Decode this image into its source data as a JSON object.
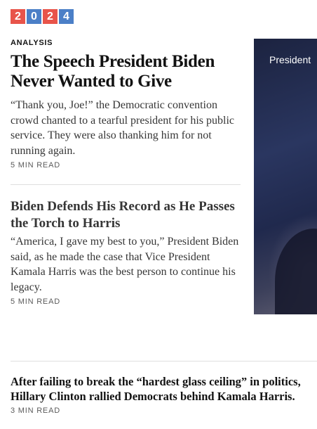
{
  "logo": {
    "digits": [
      {
        "char": "2",
        "color": "#e8544a"
      },
      {
        "char": "0",
        "color": "#4b7fc7"
      },
      {
        "char": "2",
        "color": "#e8544a"
      },
      {
        "char": "4",
        "color": "#4b7fc7"
      }
    ]
  },
  "lead": {
    "kicker": "ANALYSIS",
    "headline": "The Speech President Biden Never Wanted to Give",
    "summary": "“Thank you, Joe!” the Democratic convention crowd chanted to a tearful president for his public service. They were also thanking him for not running again.",
    "read_time": "5 MIN READ",
    "photo_caption": "President"
  },
  "second": {
    "headline": "Biden Defends His Record as He Passes the Torch to Harris",
    "summary": "“America, I gave my best to you,” President Biden said, as he made the case that Vice President Kamala Harris was the best person to continue his legacy.",
    "read_time": "5 MIN READ"
  },
  "third": {
    "headline": "After failing to break the “hardest glass ceiling” in politics, Hillary Clinton rallied Democrats behind Kamala Harris.",
    "read_time": "3 MIN READ"
  },
  "colors": {
    "logo_red": "#e8544a",
    "logo_blue": "#4b7fc7",
    "text_primary": "#121212",
    "text_secondary": "#363636",
    "divider": "#dfdfdf"
  }
}
